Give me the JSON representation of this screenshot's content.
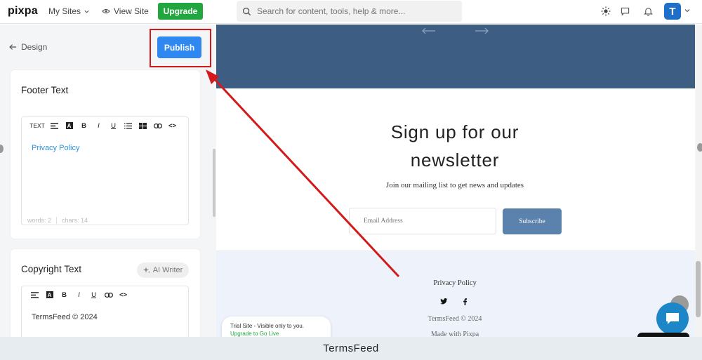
{
  "topbar": {
    "logo": "pixpa",
    "my_sites": "My Sites",
    "view_site": "View Site",
    "upgrade": "Upgrade",
    "search_placeholder": "Search for content, tools, help & more...",
    "avatar_letter": "T"
  },
  "left_panel": {
    "back_label": "Design",
    "publish_label": "Publish",
    "footer_card": {
      "title": "Footer Text",
      "toolbar_text": "TEXT",
      "content": "Privacy Policy",
      "words": "words: 2",
      "chars": "chars: 14"
    },
    "copyright_card": {
      "title": "Copyright Text",
      "ai_writer": "AI Writer",
      "content": "TermsFeed © 2024"
    }
  },
  "preview": {
    "newsletter_title": "Sign up for our newsletter",
    "newsletter_subtitle": "Join our mailing list to get news and updates",
    "email_placeholder": "Email Address",
    "subscribe": "Subscribe",
    "footer_link": "Privacy Policy",
    "footer_copyright": "TermsFeed © 2024",
    "made_with": "Made with Pixpa",
    "trial_text": "Trial Site - Visible only to you.",
    "trial_link": "Upgrade to Go Live"
  },
  "watermark": "TermsFeed",
  "colors": {
    "publish_button": "#2f88f0",
    "upgrade_button": "#22a640",
    "hero_banner": "#3d5d82",
    "subscribe_button": "#5b82ad",
    "annotation": "#d31a1a",
    "link": "#2e8fd6"
  },
  "icons": {
    "back": "arrow-left-icon",
    "view_site": "eye-icon",
    "search": "search-icon",
    "theme": "sun-icon",
    "comments": "message-square-icon",
    "notifications": "bell-icon",
    "ai_writer": "sparkle-icon",
    "social": [
      "twitter-icon",
      "facebook-icon"
    ],
    "chat": "chat-bubble-icon"
  }
}
